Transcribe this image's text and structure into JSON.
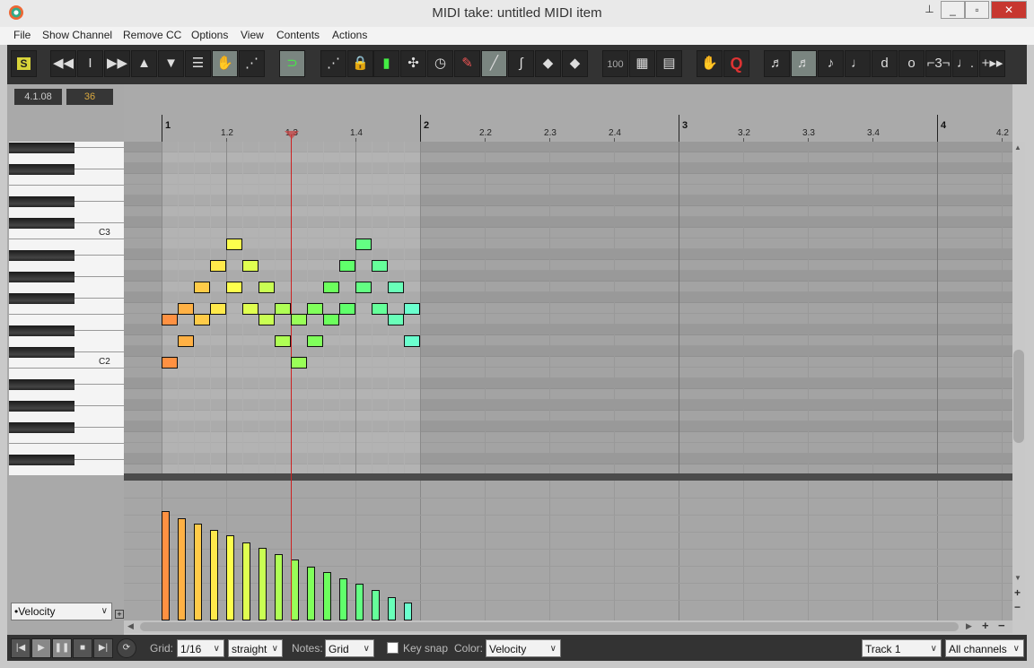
{
  "window": {
    "title": "MIDI take: untitled MIDI item",
    "controls": [
      "pin",
      "minimize",
      "restore",
      "close"
    ]
  },
  "menu": [
    "File",
    "Show Channel",
    "Remove CC",
    "Options",
    "View",
    "Contents",
    "Actions"
  ],
  "toolbar": {
    "buttons": [
      {
        "icon": "solo-s-icon",
        "glyph": "S",
        "active": false
      },
      {
        "icon": "rewind-icon",
        "glyph": "◀◀",
        "active": false
      },
      {
        "icon": "ibeam-icon",
        "glyph": "I",
        "active": false
      },
      {
        "icon": "forward-icon",
        "glyph": "▶▶",
        "active": false
      },
      {
        "icon": "arrow-up-icon",
        "glyph": "▲",
        "active": false
      },
      {
        "icon": "arrow-down-icon",
        "glyph": "▼",
        "active": false
      },
      {
        "icon": "list-view-icon",
        "glyph": "☰",
        "active": false
      },
      {
        "icon": "palette-icon",
        "glyph": "✋",
        "active": true
      },
      {
        "icon": "cc-envelope-icon",
        "glyph": "⋰",
        "active": false
      },
      {
        "icon": "snap-magnet-icon",
        "glyph": "⊃",
        "active": true
      },
      {
        "icon": "note-edit-icon",
        "glyph": "⋰",
        "active": false
      },
      {
        "icon": "lock-icon",
        "glyph": "🔒",
        "active": false
      },
      {
        "icon": "velocity-bars-icon",
        "glyph": "▮",
        "active": false
      },
      {
        "icon": "move-points-icon",
        "glyph": "✣",
        "active": false
      },
      {
        "icon": "clock-icon",
        "glyph": "◷",
        "active": false
      },
      {
        "icon": "pencil-icon",
        "glyph": "✎",
        "active": false
      },
      {
        "icon": "line-icon",
        "glyph": "╱",
        "active": true
      },
      {
        "icon": "curve-icon",
        "glyph": "∫",
        "active": false
      },
      {
        "icon": "loop-green-icon",
        "glyph": "◆",
        "active": false
      },
      {
        "icon": "loop-red-icon",
        "glyph": "◆",
        "active": false
      },
      {
        "icon": "velocity-100-icon",
        "glyph": "100",
        "active": false
      },
      {
        "icon": "grid-icon",
        "glyph": "▦",
        "active": false
      },
      {
        "icon": "grid-dotted-icon",
        "glyph": "▤",
        "active": false
      },
      {
        "icon": "hand-icon",
        "glyph": "✋",
        "active": false
      },
      {
        "icon": "quantize-icon",
        "glyph": "Q",
        "active": false
      },
      {
        "icon": "note-64th-icon",
        "glyph": "♬",
        "active": false
      },
      {
        "icon": "note-32nd-icon",
        "glyph": "♬",
        "active": true
      },
      {
        "icon": "note-eighth-icon",
        "glyph": "♪",
        "active": false
      },
      {
        "icon": "note-quarter-icon",
        "glyph": "♩",
        "active": false
      },
      {
        "icon": "note-half-icon",
        "glyph": "d",
        "active": false
      },
      {
        "icon": "note-whole-icon",
        "glyph": "o",
        "active": false
      },
      {
        "icon": "triplet-icon",
        "glyph": "⌐3¬",
        "active": false
      },
      {
        "icon": "dotted-note-icon",
        "glyph": "♩.",
        "active": false
      },
      {
        "icon": "grid-settings-icon",
        "glyph": "+▸▸",
        "active": false
      }
    ]
  },
  "readouts": {
    "position": "4.1.08",
    "pitch": "36"
  },
  "ruler": {
    "bars": [
      "1",
      "2",
      "3",
      "4"
    ],
    "beats": [
      "1.2",
      "1.3",
      "1.4",
      "2.2",
      "2.3",
      "2.4",
      "3.2",
      "3.3",
      "3.4",
      "4.2"
    ]
  },
  "piano": {
    "labels": {
      "C3": "C3",
      "C2": "C2"
    }
  },
  "midi": {
    "grid": "1/16",
    "playhead_beat": "1.3",
    "notes": [
      {
        "step": 0,
        "pitches": [
          40,
          36
        ],
        "velocity": 99
      },
      {
        "step": 1,
        "pitches": [
          41,
          38
        ],
        "velocity": 93
      },
      {
        "step": 2,
        "pitches": [
          43,
          40
        ],
        "velocity": 88
      },
      {
        "step": 3,
        "pitches": [
          45,
          41
        ],
        "velocity": 82
      },
      {
        "step": 4,
        "pitches": [
          47,
          43
        ],
        "velocity": 77
      },
      {
        "step": 5,
        "pitches": [
          45,
          41
        ],
        "velocity": 71
      },
      {
        "step": 6,
        "pitches": [
          43,
          40
        ],
        "velocity": 66
      },
      {
        "step": 7,
        "pitches": [
          41,
          38
        ],
        "velocity": 60
      },
      {
        "step": 8,
        "pitches": [
          40,
          36
        ],
        "velocity": 55
      },
      {
        "step": 9,
        "pitches": [
          41,
          38
        ],
        "velocity": 49
      },
      {
        "step": 10,
        "pitches": [
          43,
          40
        ],
        "velocity": 44
      },
      {
        "step": 11,
        "pitches": [
          45,
          41
        ],
        "velocity": 38
      },
      {
        "step": 12,
        "pitches": [
          47,
          43
        ],
        "velocity": 33
      },
      {
        "step": 13,
        "pitches": [
          45,
          41
        ],
        "velocity": 28
      },
      {
        "step": 14,
        "pitches": [
          43,
          40
        ],
        "velocity": 21
      },
      {
        "step": 15,
        "pitches": [
          41,
          38
        ],
        "velocity": 16
      }
    ],
    "velocity_range": [
      0,
      127
    ]
  },
  "cc_lane": {
    "selected": "•Velocity"
  },
  "bottom": {
    "grid_label": "Grid:",
    "grid_value": "1/16",
    "swing": "straight",
    "notes_label": "Notes:",
    "notes_value": "Grid",
    "keysnap_label": "Key snap",
    "keysnap_checked": false,
    "color_label": "Color:",
    "color_value": "Velocity",
    "track": "Track 1",
    "channels": "All channels"
  },
  "colors": {
    "playhead": "#cc2222",
    "toolbar_bg": "#333333",
    "active_button": "#7a8580"
  }
}
